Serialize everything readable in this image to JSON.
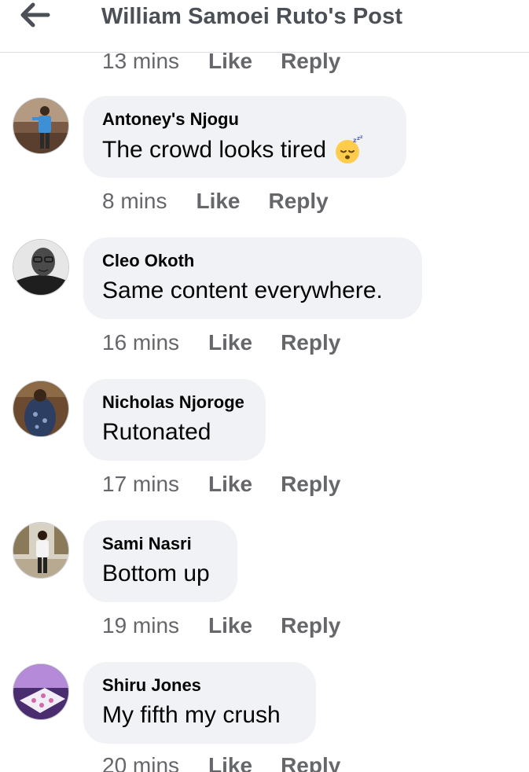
{
  "header": {
    "title": "William Samoei Ruto's Post",
    "back_icon": "arrow-left-icon"
  },
  "top_meta": {
    "time": "13 mins",
    "like": "Like",
    "reply": "Reply"
  },
  "comments": [
    {
      "author": "Antoney's Njogu",
      "text": "The crowd looks tired",
      "emoji": "sleeping-face-icon",
      "time": "8 mins",
      "like": "Like",
      "reply": "Reply"
    },
    {
      "author": "Cleo Okoth",
      "text": "Same content everywhere.",
      "time": "16 mins",
      "like": "Like",
      "reply": "Reply"
    },
    {
      "author": "Nicholas Njoroge",
      "text": "Rutonated",
      "time": "17 mins",
      "like": "Like",
      "reply": "Reply"
    },
    {
      "author": "Sami Nasri",
      "text": "Bottom up",
      "time": "19 mins",
      "like": "Like",
      "reply": "Reply"
    },
    {
      "author": "Shiru Jones",
      "text": "My fifth my crush",
      "time": "20 mins",
      "like": "Like",
      "reply": "Reply"
    }
  ],
  "colors": {
    "meta_text": "#65676b",
    "bubble_bg": "#f0f2f5",
    "title_text": "#4b4f56"
  }
}
